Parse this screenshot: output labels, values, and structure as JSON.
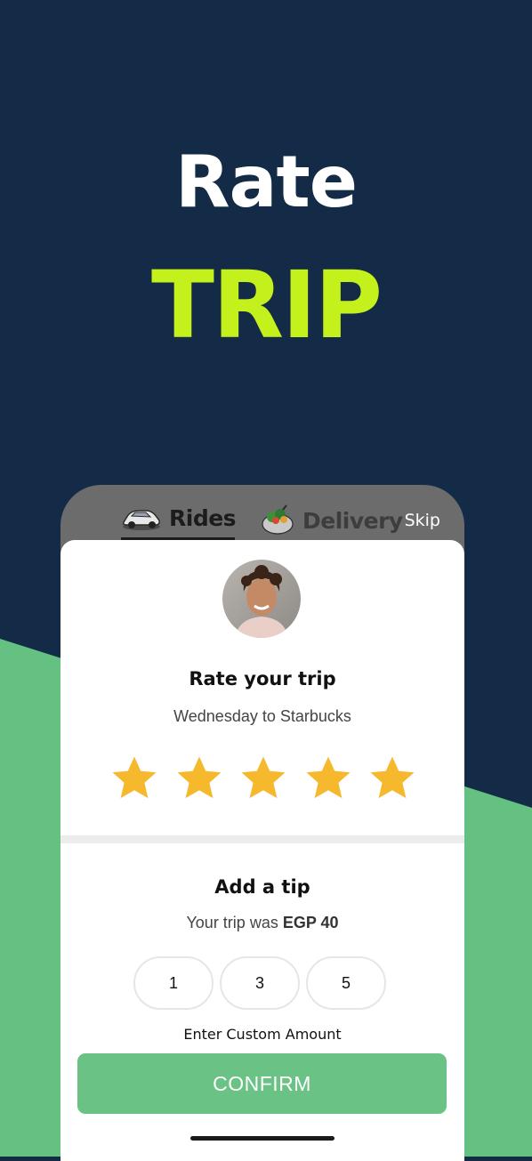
{
  "hero": {
    "line1": "Rate",
    "line2": "TRIP"
  },
  "colors": {
    "background": "#132b47",
    "accent_green": "#6ac284",
    "title_lime": "#c4f01c",
    "star": "#f6b92d"
  },
  "tabs": [
    {
      "label": "Rides",
      "icon": "car-icon",
      "selected": true
    },
    {
      "label": "Delivery",
      "icon": "food-bowl-icon",
      "selected": false
    }
  ],
  "skip_label": "Skip",
  "rating": {
    "title": "Rate your trip",
    "subtitle": "Wednesday to Starbucks",
    "stars_filled": 5,
    "stars_total": 5
  },
  "tip": {
    "title": "Add a tip",
    "trip_text": "Your trip was",
    "trip_amount": "EGP 40",
    "options": [
      "1",
      "3",
      "5"
    ],
    "custom_label": "Enter Custom Amount",
    "confirm_label": "CONFIRM"
  }
}
